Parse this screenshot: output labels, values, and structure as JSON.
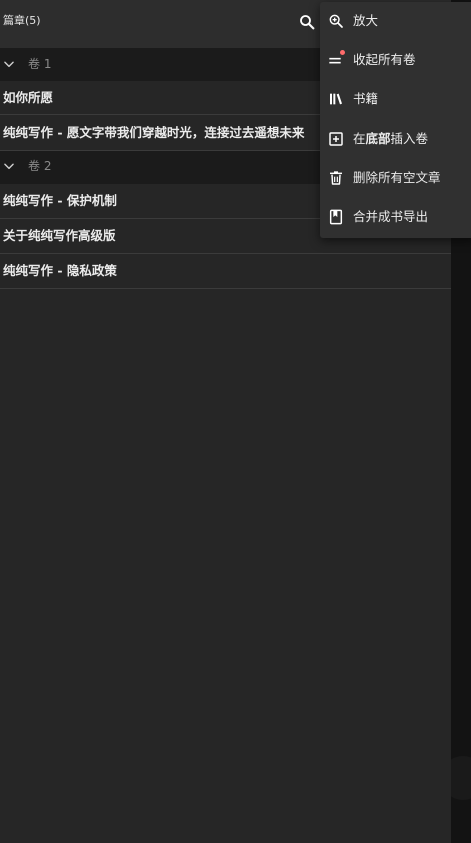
{
  "header": {
    "title": "篇章(5)"
  },
  "volumes": [
    {
      "label": "卷 1",
      "chapters": [
        {
          "label": "如你所愿"
        },
        {
          "label": "纯纯写作 - 愿文字带我们穿越时光，连接过去遥想未来"
        }
      ]
    },
    {
      "label": "卷 2",
      "chapters": [
        {
          "label": "纯纯写作 - 保护机制"
        },
        {
          "label": "关于纯纯写作高级版"
        },
        {
          "label": "纯纯写作 - 隐私政策"
        }
      ]
    }
  ],
  "menu": {
    "items": [
      {
        "label": "放大",
        "icon": "zoom-in-icon"
      },
      {
        "label": "收起所有卷",
        "icon": "collapse-lines-icon"
      },
      {
        "label": "书籍",
        "icon": "library-books-icon"
      },
      {
        "label_prefix": "在",
        "label_bold": "底部",
        "label_suffix": "插入卷",
        "icon": "add-box-icon"
      },
      {
        "label": "删除所有空文章",
        "icon": "trash-icon"
      },
      {
        "label": "合并成书导出",
        "icon": "book-bookmark-icon"
      }
    ]
  },
  "colors": {
    "panel": "#262626",
    "header": "#2d2d2d",
    "volume_row": "#1b1b1b",
    "menu": "#303030",
    "badge": "#ff6b6b"
  }
}
